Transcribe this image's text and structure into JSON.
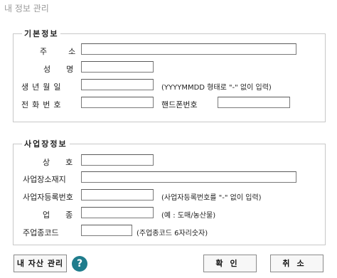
{
  "window": {
    "title": "내 정보 관리"
  },
  "basic": {
    "group_title": "기본정보",
    "address_label": "주소",
    "name_label": "성명",
    "birth_label": "생년월일",
    "birth_hint": "(YYYYMMDD 형태로 \"-\" 없이 입력)",
    "phone_label": "전화번호",
    "mobile_label": "핸드폰번호",
    "address_value": "",
    "name_value": "",
    "birth_value": "",
    "phone_value": "",
    "mobile_value": ""
  },
  "business": {
    "group_title": "사업장정보",
    "company_label": "상호",
    "location_label": "사업장소재지",
    "regno_label": "사업자등록번호",
    "regno_hint": "(사업자등록번호를 \"-\" 없이 입력)",
    "type_label": "업종",
    "type_hint": "(예 : 도매/농산물)",
    "code_label": "주업종코드",
    "code_hint": "(주업종코드 6자리숫자)",
    "company_value": "",
    "location_value": "",
    "regno_value": "",
    "type_value": "",
    "code_value": ""
  },
  "footer": {
    "assets_button": "내 자산 관리",
    "help_icon": "?",
    "help_icon_name": "help-icon",
    "help_color": "#1f7c8c",
    "confirm_button": "확인",
    "cancel_button": "취소"
  }
}
